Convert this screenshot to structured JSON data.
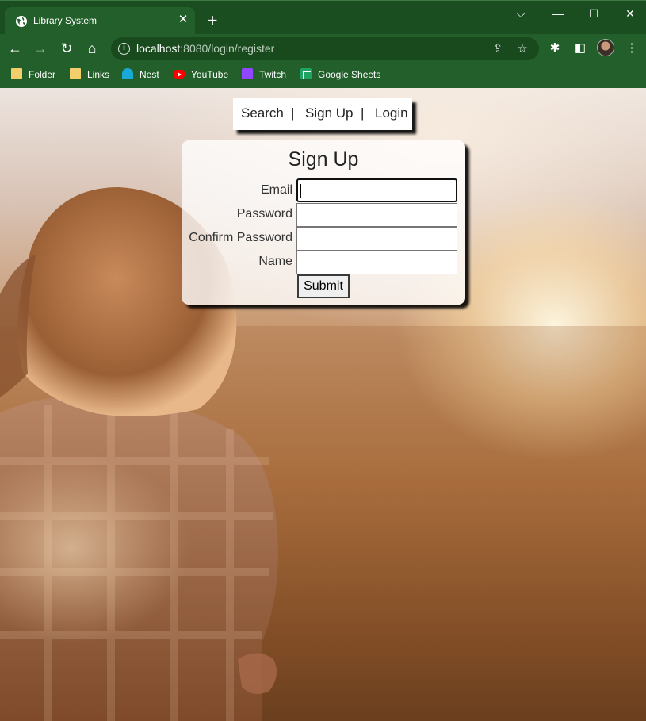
{
  "browser": {
    "tab_title": "Library System",
    "tab_close": "✕",
    "new_tab": "+",
    "window_controls": {
      "dropdown": "⌵",
      "minimize": "—",
      "maximize": "☐",
      "close": "✕"
    },
    "url_host": "localhost",
    "url_rest": ":8080/login/register",
    "icons": {
      "back": "←",
      "forward": "→",
      "reload": "↻",
      "home": "⌂",
      "share": "⇪",
      "star": "☆",
      "extensions": "✱",
      "side_panel": "◧",
      "menu": "⋮"
    },
    "bookmarks": [
      {
        "label": "Folder",
        "icon": "folder-icon"
      },
      {
        "label": "Links",
        "icon": "folder-icon"
      },
      {
        "label": "Nest",
        "icon": "nest-icon"
      },
      {
        "label": "YouTube",
        "icon": "youtube-icon"
      },
      {
        "label": "Twitch",
        "icon": "twitch-icon"
      },
      {
        "label": "Google Sheets",
        "icon": "google-sheets-icon"
      }
    ]
  },
  "nav": {
    "search": "Search",
    "signup": "Sign Up",
    "login": "Login",
    "separator": "|"
  },
  "form": {
    "title": "Sign Up",
    "email_label": "Email",
    "password_label": "Password",
    "confirm_password_label": "Confirm Password",
    "name_label": "Name",
    "email_value": "",
    "password_value": "",
    "confirm_password_value": "",
    "name_value": "",
    "submit_label": "Submit"
  },
  "colors": {
    "browser_frame": "#1a4d20",
    "toolbar": "#235f2a",
    "background_sunset_light": "#fff4d8",
    "background_sunset_dark": "#5a3418"
  }
}
